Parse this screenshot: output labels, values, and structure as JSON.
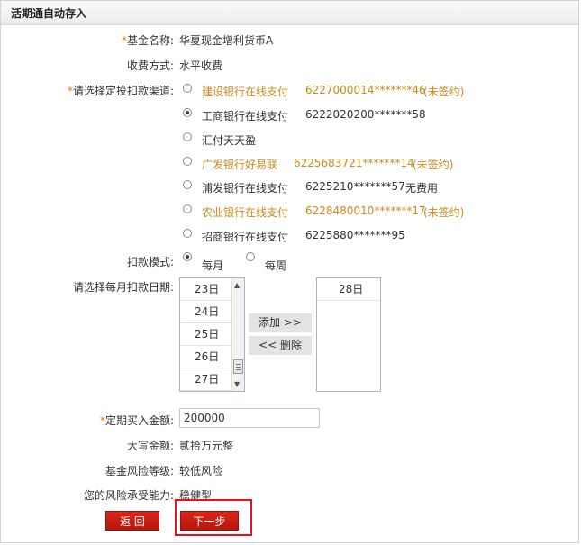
{
  "title": "活期通自动存入",
  "fund": {
    "label": "基金名称:",
    "value": "华夏现金增利货币A"
  },
  "fee": {
    "label": "收费方式:",
    "value": "水平收费"
  },
  "channels": {
    "label": "请选择定投扣款渠道:",
    "items": [
      {
        "name": "建设银行在线支付",
        "account": "6227000014*******46",
        "note": "(未签约)",
        "selected": false
      },
      {
        "name": "工商银行在线支付",
        "account": "6222020200*******58",
        "note": "",
        "selected": true
      },
      {
        "name": "汇付天天盈",
        "account": "",
        "note": "",
        "selected": false
      },
      {
        "name": "广发银行好易联",
        "account": "6225683721*******14",
        "note": "(未签约)",
        "selected": false
      },
      {
        "name": "浦发银行在线支付",
        "account": "6225210*******57",
        "note": "无费用",
        "selected": false
      },
      {
        "name": "农业银行在线支付",
        "account": "6228480010*******17",
        "note": "(未签约)",
        "selected": false
      },
      {
        "name": "招商银行在线支付",
        "account": "6225880*******95",
        "note": "",
        "selected": false
      }
    ]
  },
  "mode": {
    "label": "扣款模式:",
    "monthly": "每月",
    "weekly": "每周",
    "selected": "monthly"
  },
  "dates": {
    "label": "请选择每月扣款日期:",
    "available": [
      "23日",
      "24日",
      "25日",
      "26日",
      "27日"
    ],
    "selected": [
      "28日"
    ],
    "add_label": "添加 >>",
    "remove_label": "<< 删除"
  },
  "amount": {
    "label": "定期买入金额:",
    "value": "200000"
  },
  "amount_upper": {
    "label": "大写金额:",
    "value": "贰拾万元整"
  },
  "risk_level": {
    "label": "基金风险等级:",
    "value": "较低风险"
  },
  "risk_tolerance": {
    "label": "您的风险承受能力:",
    "value": "稳健型"
  },
  "buttons": {
    "back": "返 回",
    "next": "下一步"
  },
  "colors": {
    "accent": "#cc8a1c",
    "button_red": "#c81d12",
    "highlight": "#e8111b"
  }
}
